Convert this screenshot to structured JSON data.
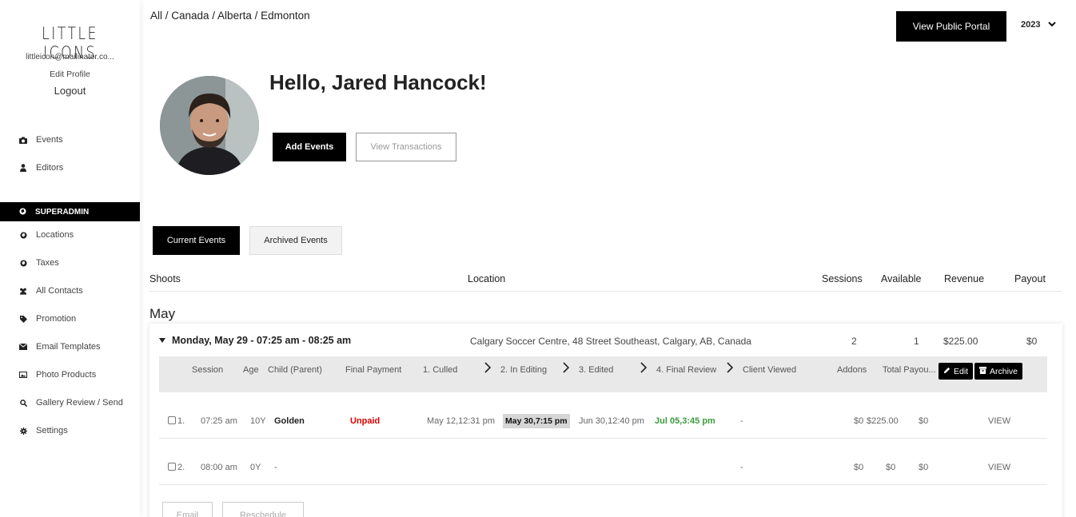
{
  "sidebar": {
    "logo": "LITTLE ICONS",
    "email": "littleicon@mailinator.co...",
    "edit_profile": "Edit Profile",
    "logout": "Logout",
    "items": [
      {
        "label": "Events",
        "icon": "camera-icon"
      },
      {
        "label": "Editors",
        "icon": "user-icon"
      },
      {
        "label": "Locations",
        "icon": "globe-icon"
      },
      {
        "label": "Taxes",
        "icon": "globe-icon"
      },
      {
        "label": "All Contacts",
        "icon": "users-icon"
      },
      {
        "label": "Promotion",
        "icon": "tag-icon"
      },
      {
        "label": "Email Templates",
        "icon": "envelope-icon"
      },
      {
        "label": "Photo Products",
        "icon": "image-icon"
      },
      {
        "label": "Gallery Review / Send",
        "icon": "search-icon"
      },
      {
        "label": "Settings",
        "icon": "gear-icon"
      }
    ],
    "superadmin": "SUPERADMIN"
  },
  "header": {
    "breadcrumb": "All / Canada / Alberta / Edmonton",
    "portal_button": "View Public Portal",
    "year": "2023"
  },
  "profile": {
    "greeting": "Hello, Jared Hancock!",
    "add_events": "Add Events",
    "view_transactions": "View Transactions"
  },
  "tabs": {
    "current": "Current Events",
    "archived": "Archived Events"
  },
  "table": {
    "headers": {
      "shoots": "Shoots",
      "location": "Location",
      "sessions": "Sessions",
      "available": "Available",
      "revenue": "Revenue",
      "payout": "Payout"
    },
    "month": "May"
  },
  "event": {
    "date": "Monday, May 29 - 07:25 am - 08:25 am",
    "location": "Calgary Soccer Centre, 48 Street Southeast, Calgary, AB, Canada",
    "sessions": "2",
    "available": "1",
    "revenue": "$225.00",
    "payout": "$0"
  },
  "subheaders": {
    "session": "Session",
    "age": "Age",
    "child": "Child (Parent)",
    "final_payment": "Final Payment",
    "culled": "1. Culled",
    "in_editing": "2. In Editing",
    "edited": "3. Edited",
    "final_review": "4. Final Review",
    "client_viewed": "Client Viewed",
    "addons": "Addons",
    "total_payout": "Total Payou...",
    "edit": "Edit",
    "archive": "Archive"
  },
  "rows": [
    {
      "num": "1.",
      "time": "07:25 am",
      "age": "10Y",
      "child": "Golden",
      "payment": "Unpaid",
      "culled": "May 12,12:31 pm",
      "in_editing": "May 30,7:15 pm",
      "edited": "Jun 30,12:40 pm",
      "final_review": "Jul 05,3:45 pm",
      "client_viewed": "-",
      "addons": "$0",
      "total": "$225.00",
      "payout": "$0",
      "view": "VIEW"
    },
    {
      "num": "2.",
      "time": "08:00 am",
      "age": "0Y",
      "child": "-",
      "client_viewed": "-",
      "addons": "$0",
      "total": "$0",
      "payout": "$0",
      "view": "VIEW"
    }
  ],
  "bottom": {
    "email": "Email",
    "reschedule": "Reschedule"
  }
}
